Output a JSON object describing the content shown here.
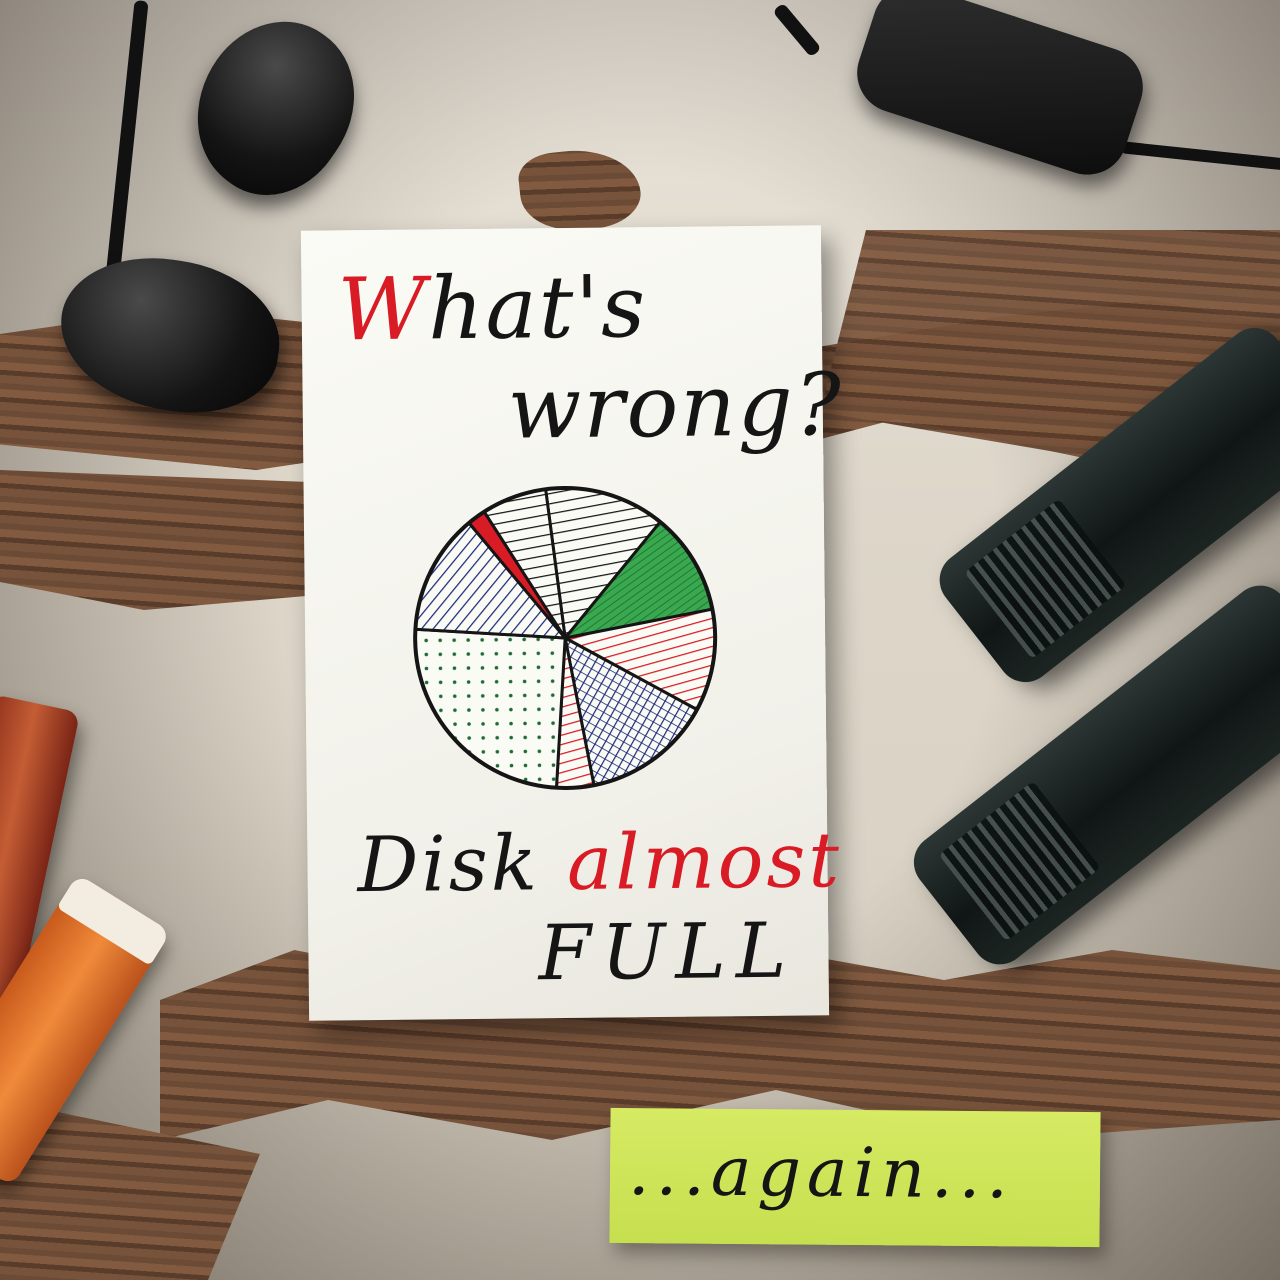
{
  "card": {
    "line1": "What's",
    "line2": "wrong?",
    "line3_a": "Disk ",
    "line3_b": "almost",
    "line4": "FULL"
  },
  "note": {
    "text": "...again..."
  },
  "colors": {
    "red": "#d81b24",
    "green": "#1e8c3a",
    "blue": "#1d2b7a",
    "black": "#151515",
    "note": "#cfe45a"
  },
  "pie_slices": [
    {
      "fill": "black-stripes",
      "value": 13
    },
    {
      "fill": "green",
      "value": 11
    },
    {
      "fill": "red-stripes",
      "value": 11
    },
    {
      "fill": "blue-crosshatch",
      "value": 14
    },
    {
      "fill": "red-stripes",
      "value": 4
    },
    {
      "fill": "green-dots",
      "value": 25
    },
    {
      "fill": "blue-stripes",
      "value": 13
    },
    {
      "fill": "red",
      "value": 2
    },
    {
      "fill": "black-stripes",
      "value": 7
    }
  ]
}
